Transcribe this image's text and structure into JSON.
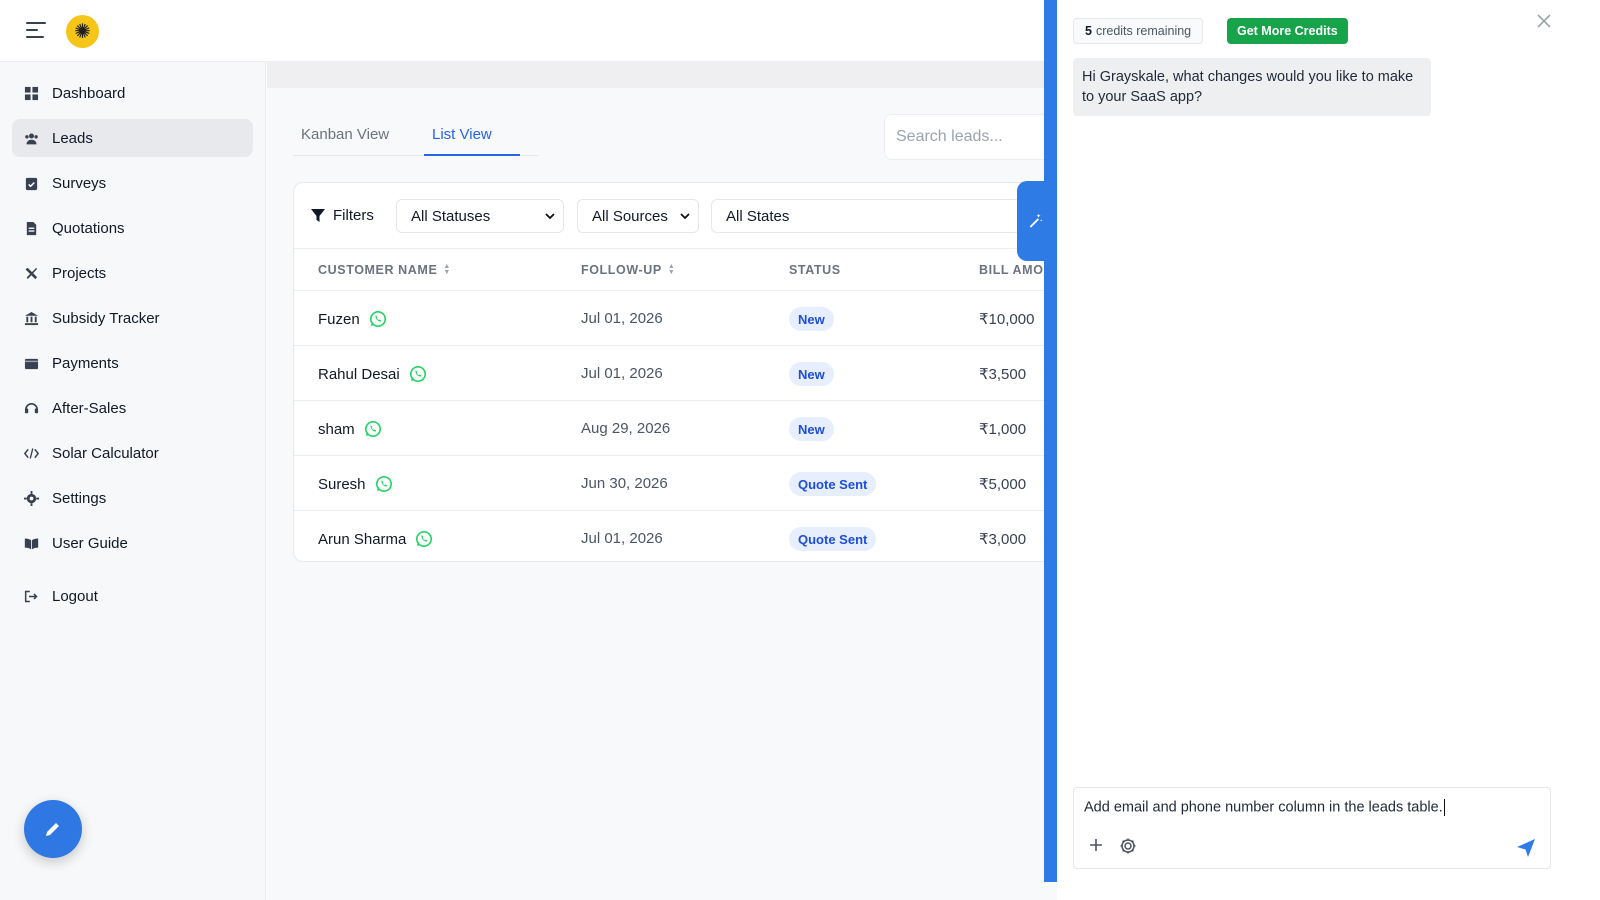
{
  "colors": {
    "accent": "#2f7be6",
    "link": "#2563eb",
    "logo": "#f5c518",
    "success": "#16a34a",
    "badge_bg": "#e7efff",
    "whatsapp": "#25d366"
  },
  "header": {
    "menu_icon": "hamburger-icon",
    "logo_icon": "sun-gear-icon"
  },
  "sidebar": {
    "items": [
      {
        "label": "Dashboard",
        "icon": "grid-icon"
      },
      {
        "label": "Leads",
        "icon": "users-icon",
        "active": true
      },
      {
        "label": "Surveys",
        "icon": "clipboard-check-icon"
      },
      {
        "label": "Quotations",
        "icon": "file-invoice-icon"
      },
      {
        "label": "Projects",
        "icon": "tools-icon"
      },
      {
        "label": "Subsidy Tracker",
        "icon": "bank-icon"
      },
      {
        "label": "Payments",
        "icon": "wallet-icon"
      },
      {
        "label": "After-Sales",
        "icon": "headset-icon"
      },
      {
        "label": "Solar Calculator",
        "icon": "code-icon"
      },
      {
        "label": "Settings",
        "icon": "gear-icon"
      },
      {
        "label": "User Guide",
        "icon": "book-icon"
      },
      {
        "label": "Logout",
        "icon": "logout-icon"
      }
    ]
  },
  "main": {
    "tabs": [
      {
        "label": "Kanban View",
        "active": false
      },
      {
        "label": "List View",
        "active": true
      }
    ],
    "search_placeholder": "Search leads...",
    "filters": {
      "label": "Filters",
      "status": "All Statuses",
      "source": "All Sources",
      "state": "All States"
    },
    "table": {
      "columns": [
        "CUSTOMER NAME",
        "FOLLOW-UP",
        "STATUS",
        "BILL AMOU"
      ],
      "rows": [
        {
          "name": "Fuzen",
          "follow_up": "Jul 01, 2026",
          "status": "New",
          "amount": "₹10,000"
        },
        {
          "name": "Rahul Desai",
          "follow_up": "Jul 01, 2026",
          "status": "New",
          "amount": "₹3,500"
        },
        {
          "name": "sham",
          "follow_up": "Aug 29, 2026",
          "status": "New",
          "amount": "₹1,000"
        },
        {
          "name": "Suresh",
          "follow_up": "Jun 30, 2026",
          "status": "Quote Sent",
          "amount": "₹5,000"
        },
        {
          "name": "Arun Sharma",
          "follow_up": "Jul 01, 2026",
          "status": "Quote Sent",
          "amount": "₹3,000"
        }
      ]
    }
  },
  "chat": {
    "credits_count": "5",
    "credits_text": "credits remaining",
    "get_credits_label": "Get More Credits",
    "message": "Hi Grayskale, what changes would you like to make to your SaaS app?",
    "input_value": "Add email and phone number column in the leads table."
  }
}
